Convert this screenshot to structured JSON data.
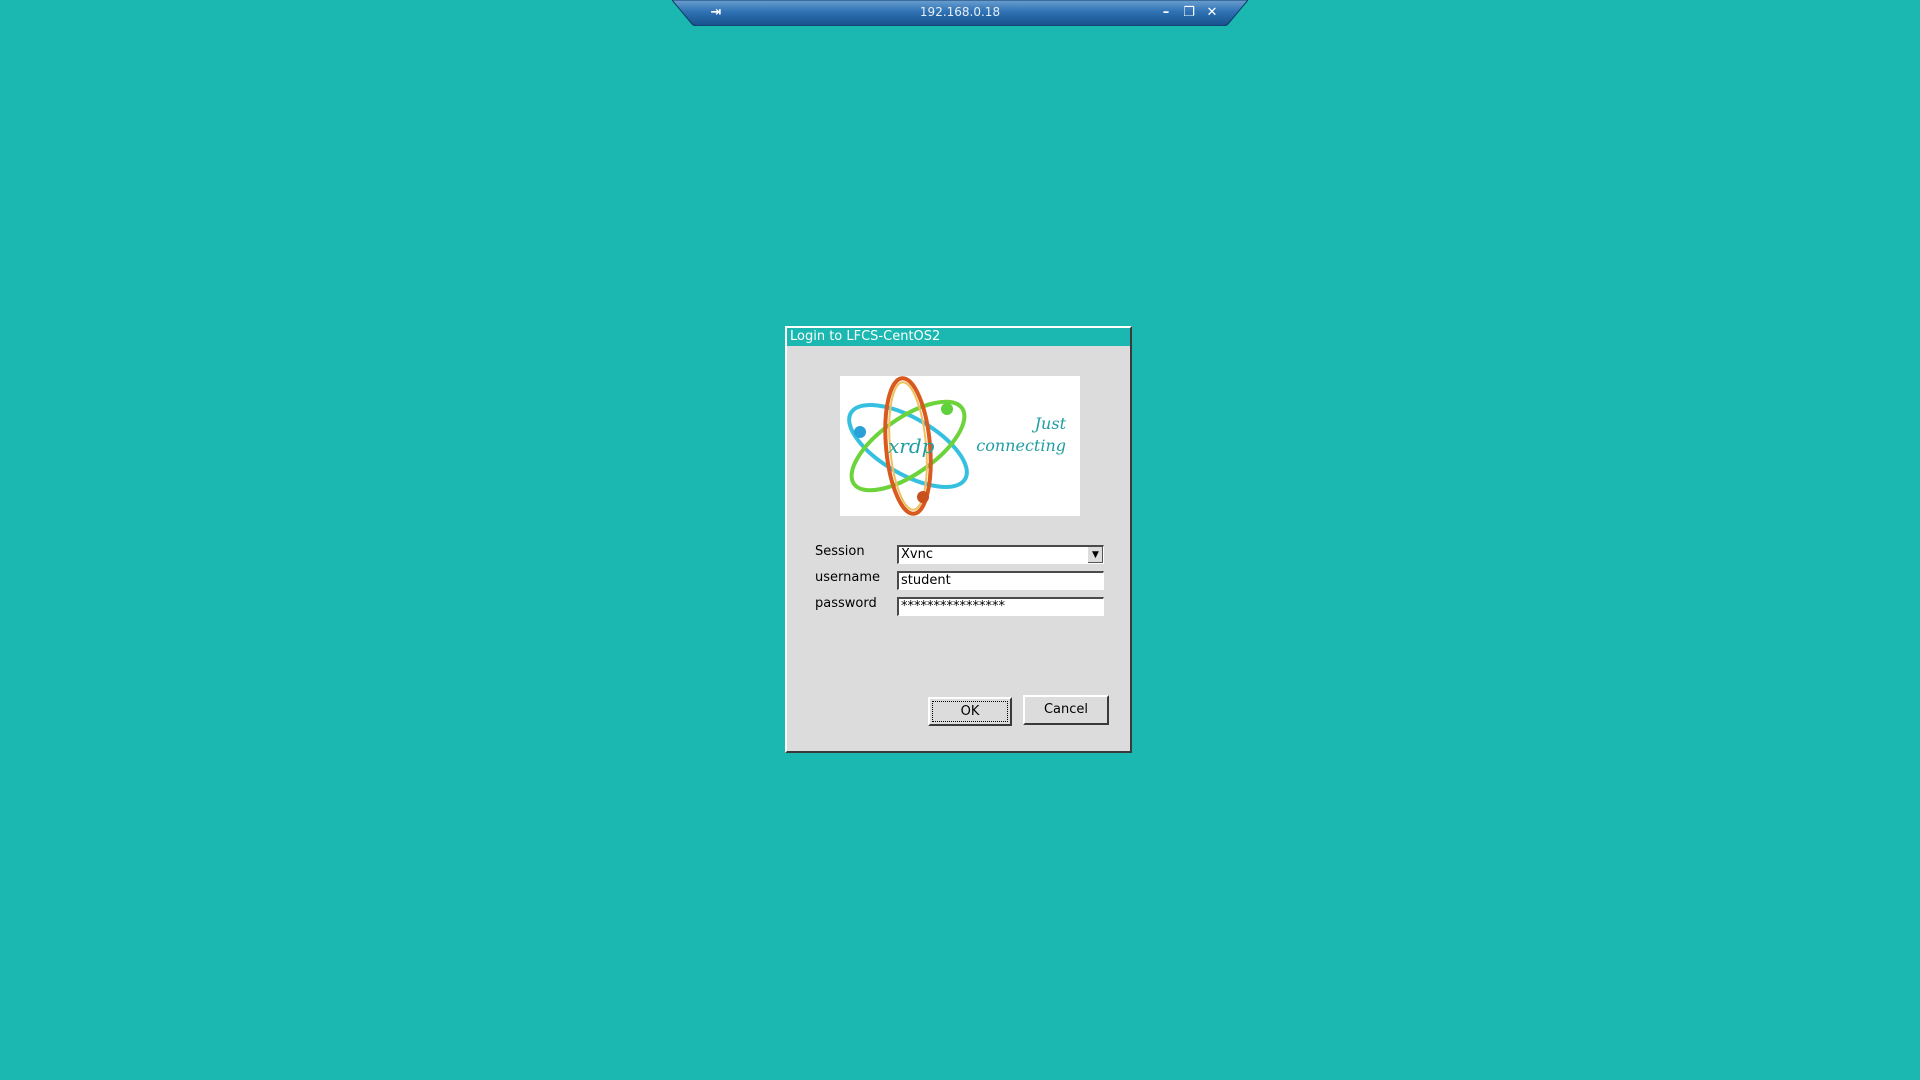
{
  "connection_bar": {
    "title": "192.168.0.18",
    "icons": {
      "pin": "pin-icon",
      "minimize": "minimize-icon",
      "restore": "restore-icon",
      "close": "close-icon"
    },
    "colors": {
      "bar_top": "#6b9fd0",
      "bar_bottom": "#1f5fa0"
    }
  },
  "dialog": {
    "title": "Login to LFCS-CentOS2",
    "logo": {
      "brand_text": "xrdp",
      "tagline_line1": "Just",
      "tagline_line2": "connecting"
    },
    "fields": {
      "session_label": "Session",
      "session_value": "Xvnc",
      "username_label": "username",
      "username_value": "student",
      "password_label": "password",
      "password_value": "****************"
    },
    "buttons": {
      "ok": "OK",
      "cancel": "Cancel"
    }
  },
  "colors": {
    "desktop_background": "#1ab8b0",
    "dialog_titlebar": "#1ab8b0",
    "dialog_body": "#dcdcdc"
  }
}
